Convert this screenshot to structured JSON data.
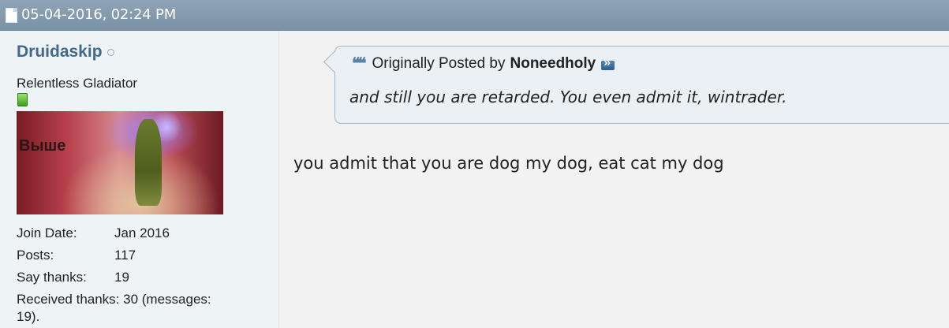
{
  "post": {
    "date": "05-04-2016, 02:24 PM"
  },
  "user": {
    "name": "Druidaskip",
    "title": "Relentless Gladiator",
    "avatar_text": "Выше",
    "stats": {
      "join_label": "Join Date:",
      "join_value": "Jan 2016",
      "posts_label": "Posts:",
      "posts_value": "117",
      "thanks_label": "Say thanks:",
      "thanks_value": "19",
      "received_line1": "Received thanks: 30 (messages:",
      "received_line2": "19)."
    }
  },
  "quote": {
    "prefix": "Originally Posted by",
    "author": "Noneedholy",
    "text": "and still you are retarded. You even admit it, wintrader."
  },
  "body": {
    "text": "you admit that you are dog my dog, eat cat my dog"
  },
  "colors": {
    "header": "#8fa4b6",
    "username": "#3f6a8e",
    "quote_border": "#9db5c9"
  }
}
